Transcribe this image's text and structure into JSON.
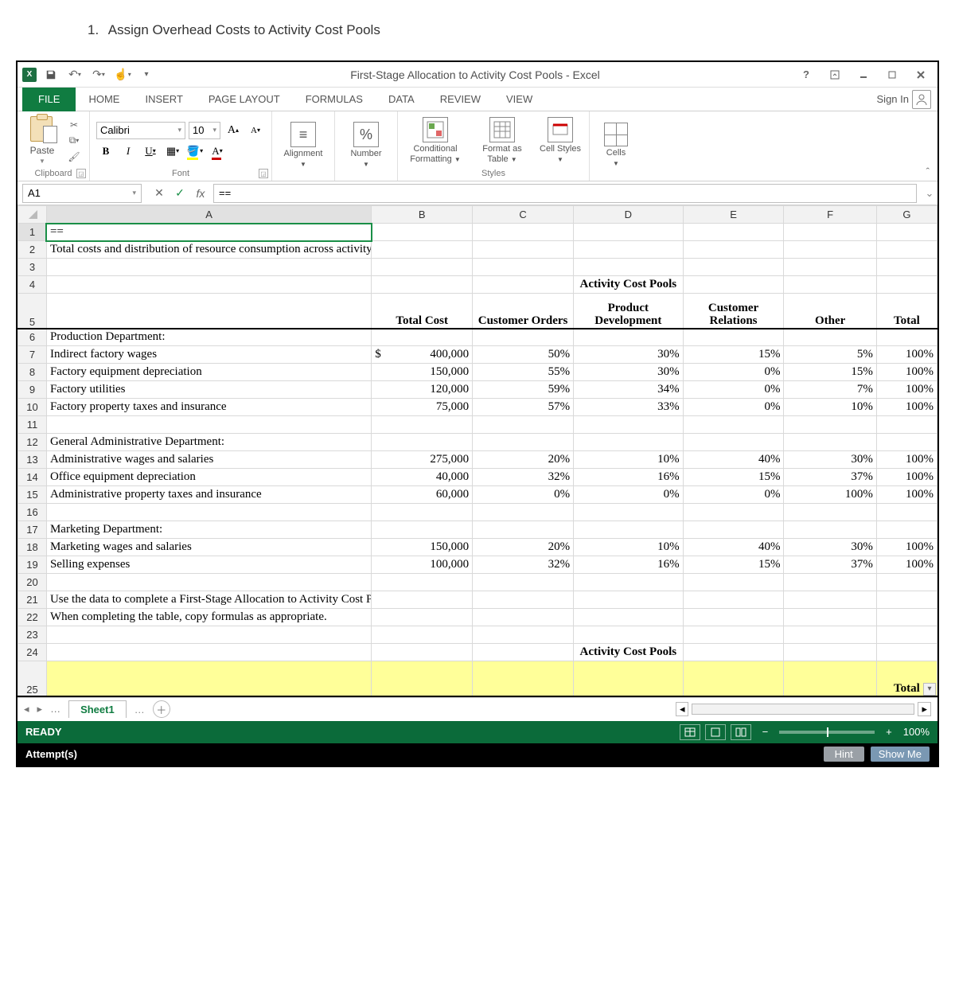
{
  "instruction": "Assign Overhead Costs to Activity Cost Pools",
  "window_title": "First-Stage Allocation to Activity Cost Pools - Excel",
  "tabs": {
    "file": "FILE",
    "home": "HOME",
    "insert": "INSERT",
    "page_layout": "PAGE LAYOUT",
    "formulas": "FORMULAS",
    "data": "DATA",
    "review": "REVIEW",
    "view": "VIEW"
  },
  "signin": "Sign In",
  "ribbon": {
    "paste": "Paste",
    "clipboard": "Clipboard",
    "font_name": "Calibri",
    "font_size": "10",
    "font": "Font",
    "alignment": "Alignment",
    "number": "Number",
    "cond_fmt": "Conditional Formatting",
    "fmt_table": "Format as Table",
    "cell_styles": "Cell Styles",
    "styles": "Styles",
    "cells": "Cells"
  },
  "namebox": "A1",
  "formula": "==",
  "columns": [
    "A",
    "B",
    "C",
    "D",
    "E",
    "F",
    "G"
  ],
  "rows": [
    {
      "n": 1,
      "a": "=="
    },
    {
      "n": 2,
      "a": "Total costs and distribution of resource consumption across activity cost pools:"
    },
    {
      "n": 3
    },
    {
      "n": 4,
      "d": "Activity Cost Pools",
      "bold_center_span": true
    },
    {
      "n": 5,
      "b": "Total Cost",
      "c": "Customer Orders",
      "d": "Product Development",
      "e": "Customer Relations",
      "f": "Other",
      "g": "Total",
      "header_row": true
    },
    {
      "n": 6,
      "a": "Production Department:"
    },
    {
      "n": 7,
      "a": " Indirect factory wages",
      "b": "$    400,000",
      "c": "50%",
      "d": "30%",
      "e": "15%",
      "f": "5%",
      "g": "100%"
    },
    {
      "n": 8,
      "a": " Factory equipment depreciation",
      "b": "150,000",
      "c": "55%",
      "d": "30%",
      "e": "0%",
      "f": "15%",
      "g": "100%"
    },
    {
      "n": 9,
      "a": " Factory utilities",
      "b": "120,000",
      "c": "59%",
      "d": "34%",
      "e": "0%",
      "f": "7%",
      "g": "100%"
    },
    {
      "n": 10,
      "a": " Factory property taxes and insurance",
      "b": "75,000",
      "c": "57%",
      "d": "33%",
      "e": "0%",
      "f": "10%",
      "g": "100%"
    },
    {
      "n": 11
    },
    {
      "n": 12,
      "a": "General Administrative Department:"
    },
    {
      "n": 13,
      "a": " Administrative wages and salaries",
      "b": "275,000",
      "c": "20%",
      "d": "10%",
      "e": "40%",
      "f": "30%",
      "g": "100%"
    },
    {
      "n": 14,
      "a": " Office equipment depreciation",
      "b": "40,000",
      "c": "32%",
      "d": "16%",
      "e": "15%",
      "f": "37%",
      "g": "100%"
    },
    {
      "n": 15,
      "a": " Administrative property taxes and insurance",
      "b": "60,000",
      "c": "0%",
      "d": "0%",
      "e": "0%",
      "f": "100%",
      "g": "100%"
    },
    {
      "n": 16
    },
    {
      "n": 17,
      "a": "Marketing Department:"
    },
    {
      "n": 18,
      "a": " Marketing wages and salaries",
      "b": "150,000",
      "c": "20%",
      "d": "10%",
      "e": "40%",
      "f": "30%",
      "g": "100%"
    },
    {
      "n": 19,
      "a": " Selling expenses",
      "b": "100,000",
      "c": "32%",
      "d": "16%",
      "e": "15%",
      "f": "37%",
      "g": "100%"
    },
    {
      "n": 20
    },
    {
      "n": 21,
      "a": "Use the data to complete a First-Stage Allocation to Activity Cost Pools."
    },
    {
      "n": 22,
      "a": "When completing the table, copy formulas as appropriate."
    },
    {
      "n": 23
    },
    {
      "n": 24,
      "d": "Activity Cost Pools",
      "bold_center_span": true
    },
    {
      "n": 25,
      "g": "Total",
      "yellow": true,
      "header_row": true
    }
  ],
  "sheet_tab": "Sheet1",
  "status": "READY",
  "zoom": "100%",
  "attempts": "Attempt(s)",
  "hint": "Hint",
  "showme": "Show Me"
}
